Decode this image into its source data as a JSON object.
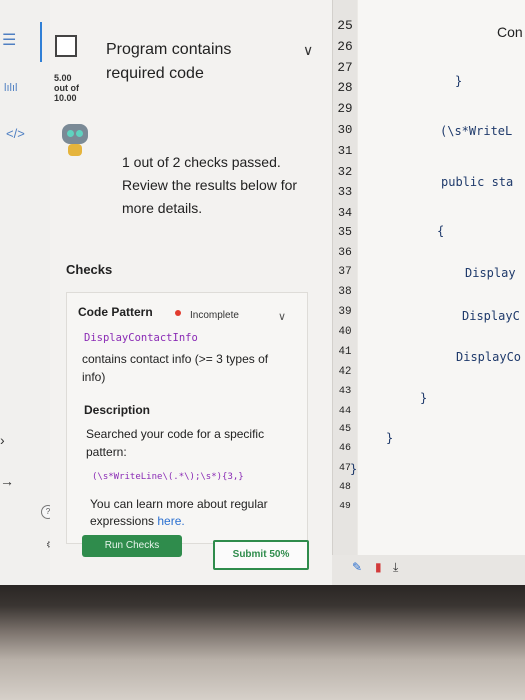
{
  "rail": {
    "menu_icon": "☰",
    "chart_icon": "lılıl",
    "code_tag": "</>",
    "help": "?",
    "gear": "⚙"
  },
  "header": {
    "title": "Program contains required code",
    "score_value": "5.00",
    "score_out_of": "out of",
    "score_max": "10.00"
  },
  "summary": {
    "text": "1 out of 2 checks passed. Review the results below for more details."
  },
  "checks": {
    "heading": "Checks",
    "item": {
      "title": "Code Pattern",
      "status": "Incomplete",
      "status_color": "#e23b2e",
      "function_name": "DisplayContactInfo",
      "requirement": "contains contact info (>= 3 types of info)",
      "description_heading": "Description",
      "description": "Searched your code for a specific pattern:",
      "pattern": "(\\s*WriteLine\\(.*\\);\\s*){3,}",
      "learn_more_prefix": "You can learn more about regular expressions ",
      "learn_more_link": "here."
    }
  },
  "buttons": {
    "run": "Run Checks",
    "submit": "Submit 50%"
  },
  "line_numbers": [
    "25",
    "26",
    "27",
    "28",
    "29",
    "30",
    "31",
    "32",
    "33",
    "34",
    "35",
    "36",
    "37",
    "38",
    "39",
    "40",
    "41",
    "42",
    "43",
    "44",
    "45",
    "46",
    "47",
    "48",
    "49"
  ],
  "code_lines": {
    "l25": "Con",
    "l27": "}",
    "l29": "(\\s*WriteL",
    "l31": "public sta",
    "l33": "{",
    "l35": "Display",
    "l37": "DisplayC",
    "l39": "DisplayCo",
    "l41": "}",
    "l43": "}",
    "l45": "}"
  },
  "colors": {
    "accent": "#2f8c4c",
    "link": "#2a6fd0",
    "code_keyword": "#1f3a6b",
    "pattern": "#8a2bb5"
  }
}
